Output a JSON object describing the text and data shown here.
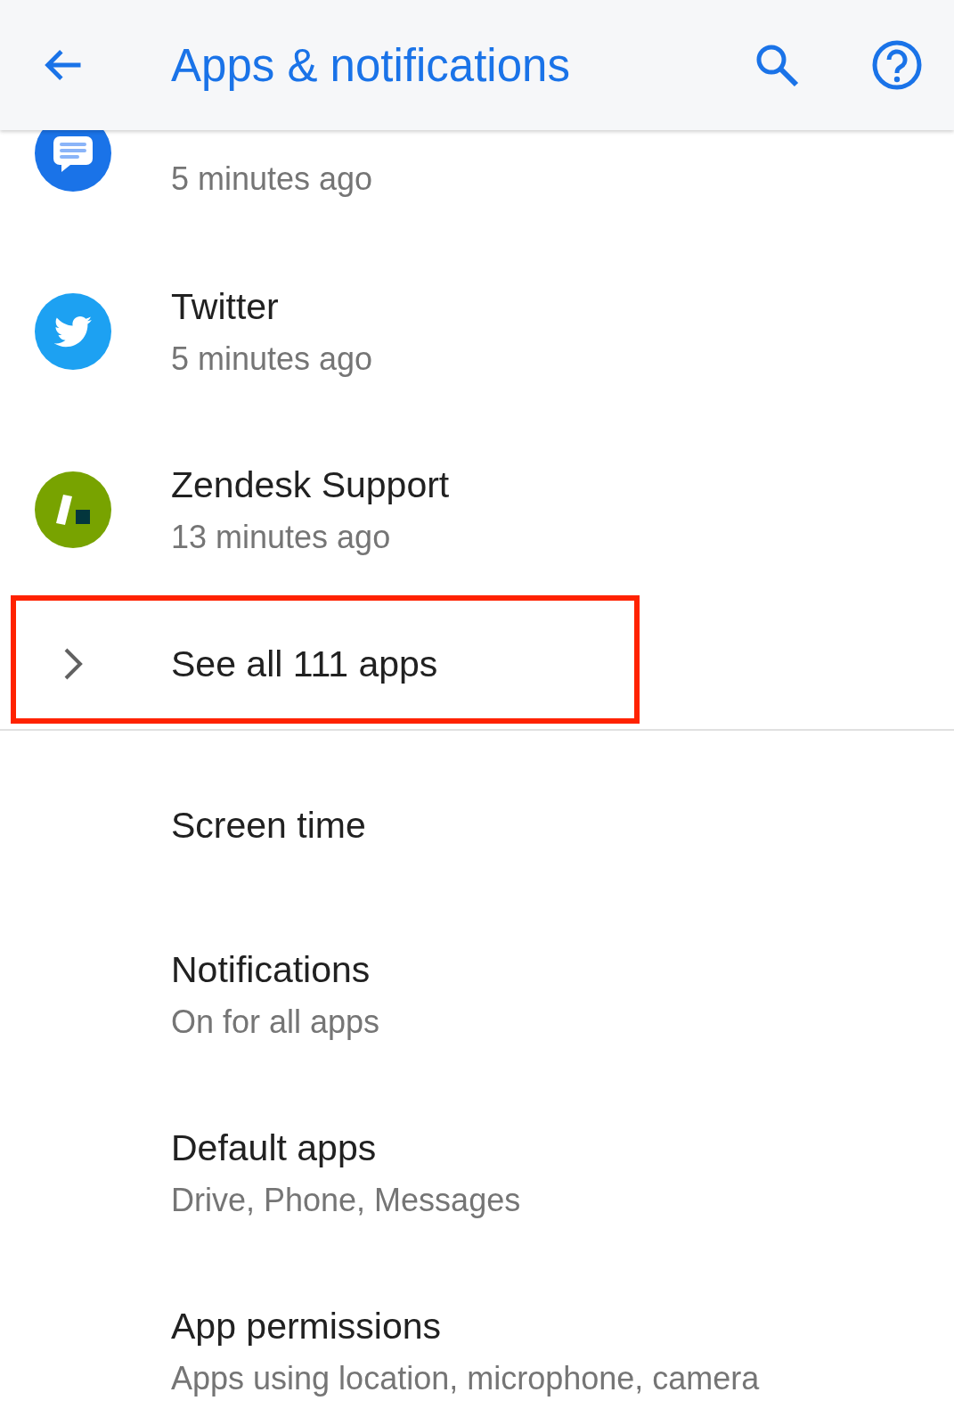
{
  "app_bar": {
    "title": "Apps & notifications"
  },
  "recent_apps": [
    {
      "kind": "messages",
      "subtitle": "5 minutes ago"
    },
    {
      "kind": "twitter",
      "title": "Twitter",
      "subtitle": "5 minutes ago"
    },
    {
      "kind": "zendesk",
      "title": "Zendesk Support",
      "subtitle": "13 minutes ago"
    }
  ],
  "see_all": {
    "label": "See all 111 apps",
    "highlighted": true
  },
  "settings": [
    {
      "title": "Screen time"
    },
    {
      "title": "Notifications",
      "subtitle": "On for all apps"
    },
    {
      "title": "Default apps",
      "subtitle": "Drive, Phone, Messages"
    },
    {
      "title": "App permissions",
      "subtitle": "Apps using location, microphone, camera"
    }
  ]
}
